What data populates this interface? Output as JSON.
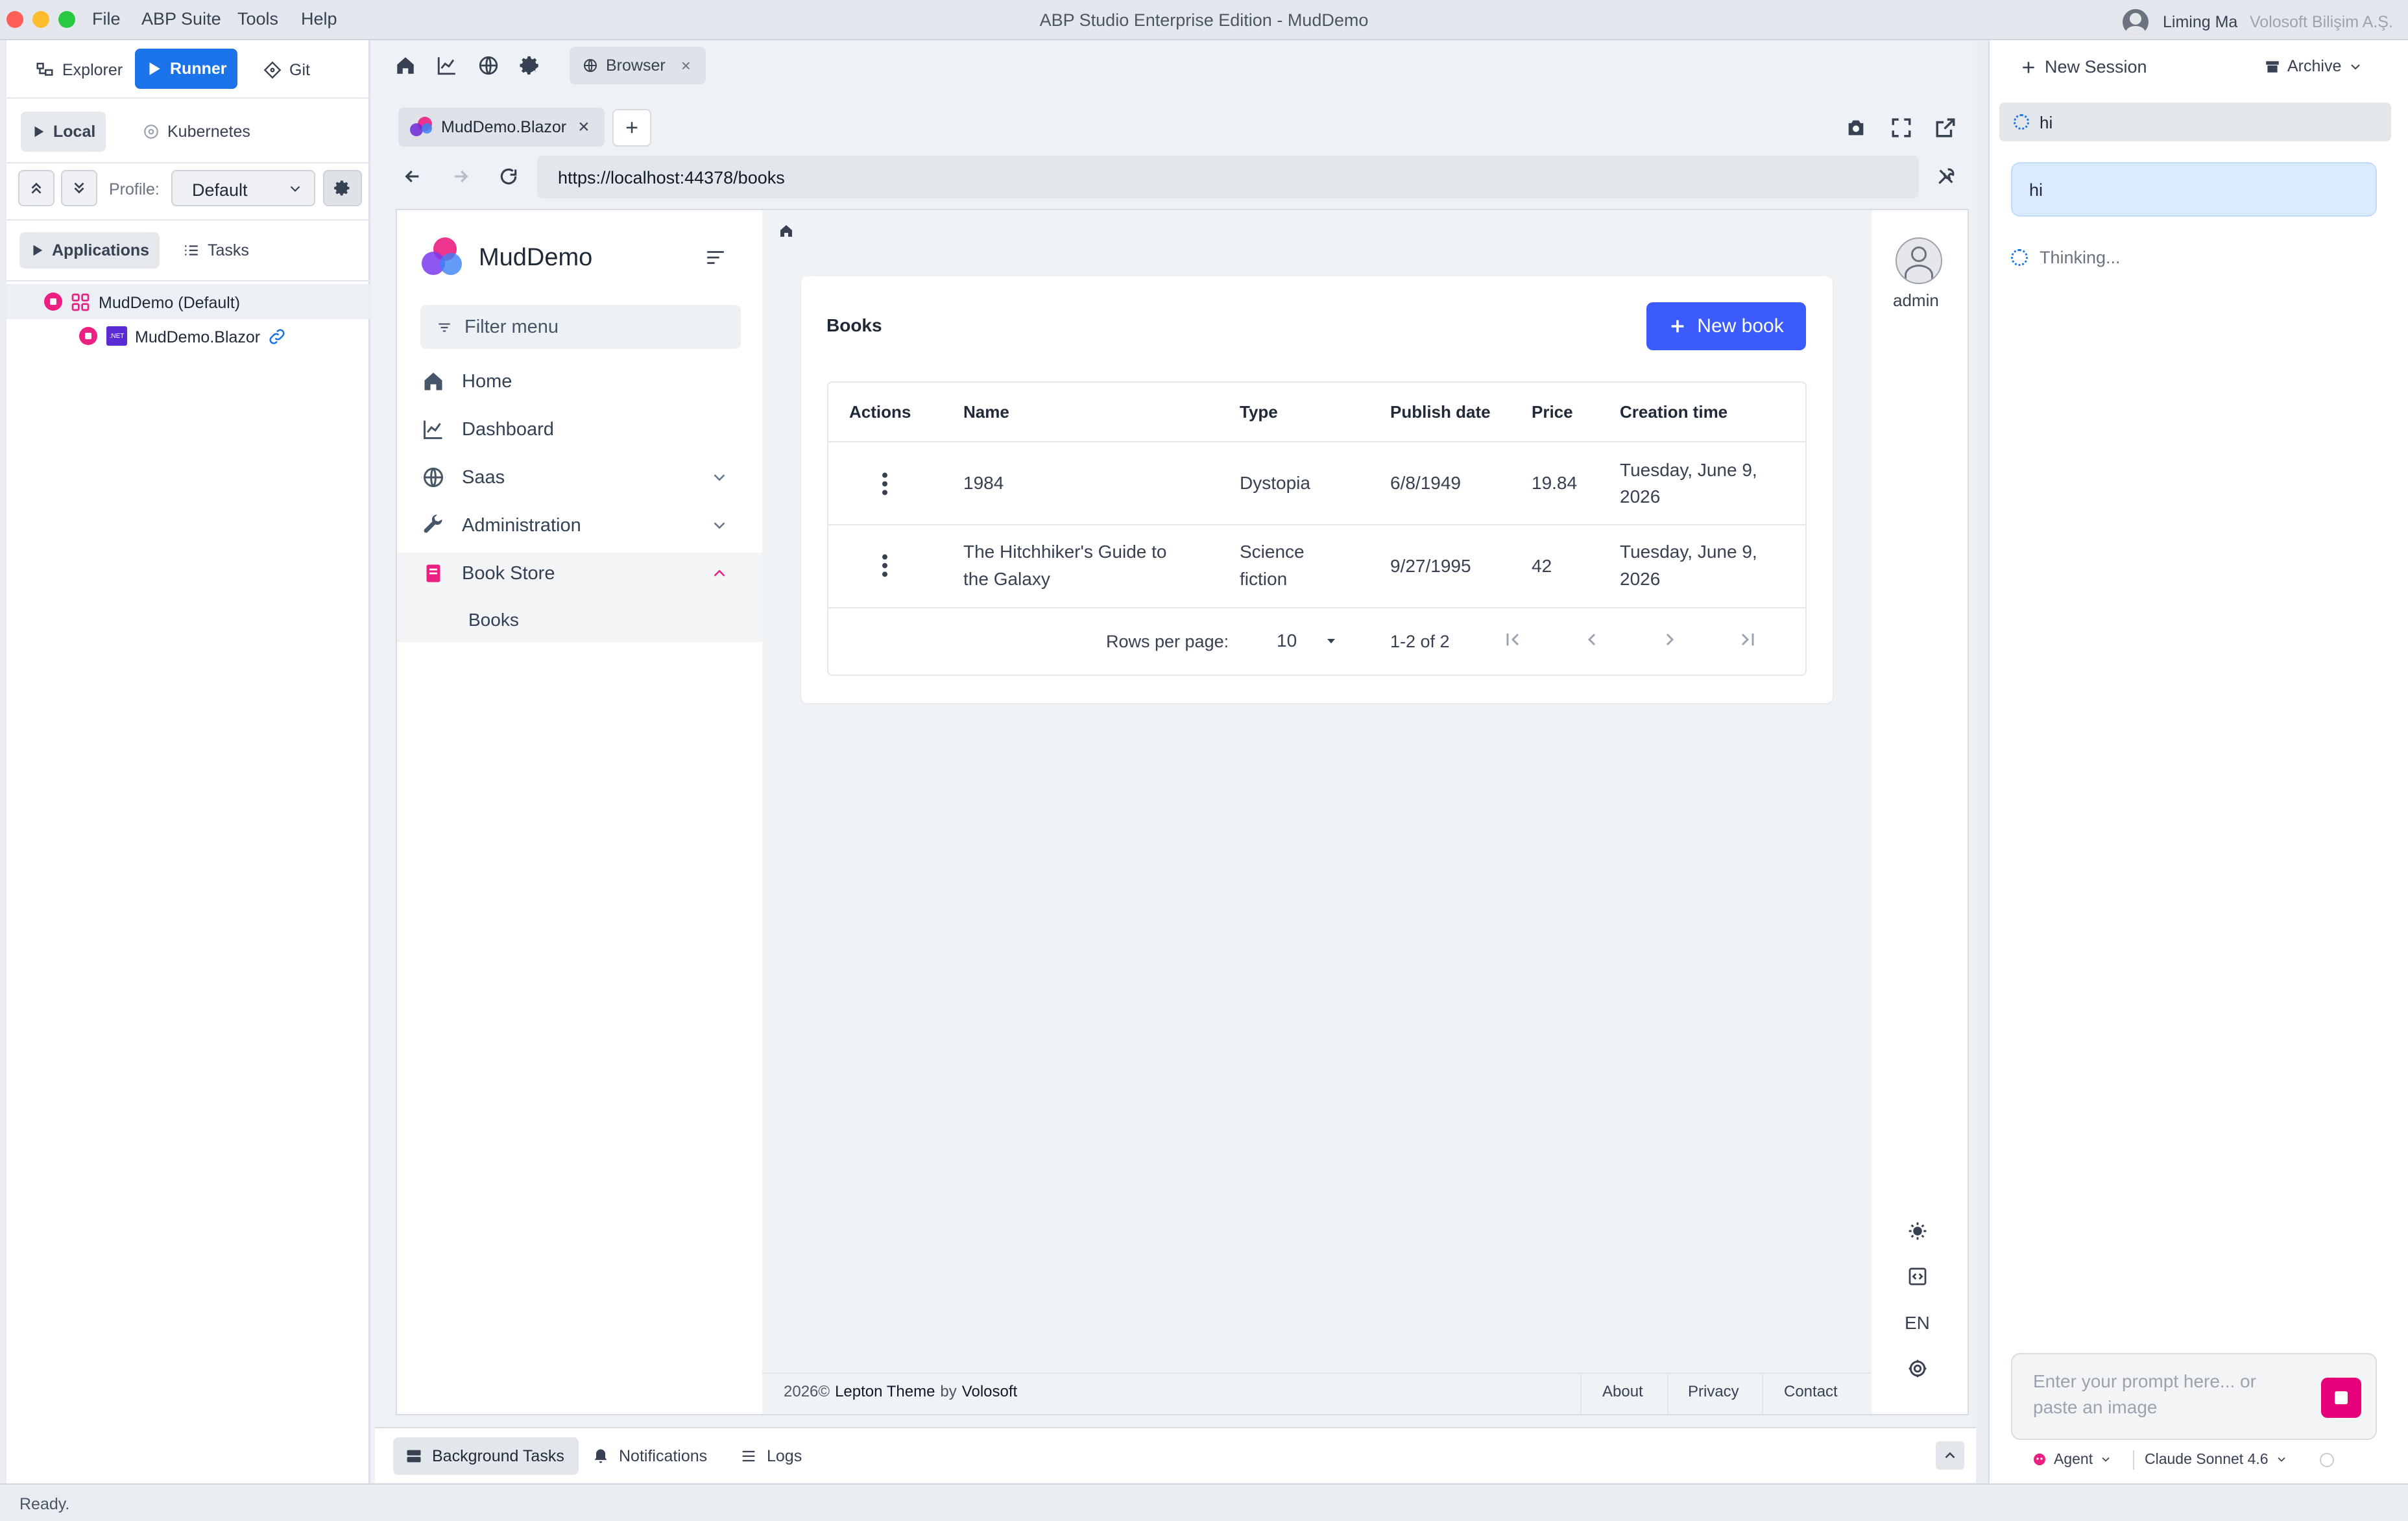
{
  "titlebar": {
    "menus": [
      "File",
      "ABP Suite",
      "Tools",
      "Help"
    ],
    "title": "ABP Studio Enterprise Edition - MudDemo",
    "user_name": "Liming Ma",
    "org_name": "Volosoft Bilişim A.Ş."
  },
  "left": {
    "tabs": {
      "explorer": "Explorer",
      "runner": "Runner",
      "git": "Git"
    },
    "env": {
      "local": "Local",
      "kubernetes": "Kubernetes"
    },
    "profile_label": "Profile:",
    "profile_value": "Default",
    "subtabs": {
      "applications": "Applications",
      "tasks": "Tasks"
    },
    "tree": [
      {
        "label": "MudDemo (Default)"
      },
      {
        "label": "MudDemo.Blazor"
      }
    ]
  },
  "toolbar": {
    "browser_tab": "Browser"
  },
  "browser": {
    "tab_label": "MudDemo.Blazor",
    "url": "https://localhost:44378/books"
  },
  "app": {
    "brand": "MudDemo",
    "filter_placeholder": "Filter menu",
    "nav": {
      "home": "Home",
      "dashboard": "Dashboard",
      "saas": "Saas",
      "administration": "Administration",
      "book_store": "Book Store",
      "books": "Books"
    },
    "user": "admin",
    "language": "EN",
    "books": {
      "title": "Books",
      "new_button": "New book",
      "columns": [
        "Actions",
        "Name",
        "Type",
        "Publish date",
        "Price",
        "Creation time"
      ],
      "rows": [
        {
          "name": "1984",
          "type": "Dystopia",
          "publish_date": "6/8/1949",
          "price": "19.84",
          "creation_line1": "Tuesday, June 9,",
          "creation_line2": "2026"
        },
        {
          "name_line1": "The Hitchhiker's Guide to",
          "name_line2": "the Galaxy",
          "type_line1": "Science",
          "type_line2": "fiction",
          "publish_date": "9/27/1995",
          "price": "42",
          "creation_line1": "Tuesday, June 9,",
          "creation_line2": "2026"
        }
      ],
      "rows_per_page_label": "Rows per page:",
      "rows_per_page": "10",
      "range": "1-2 of 2"
    },
    "footer": {
      "year": "2026©",
      "theme": "Lepton Theme",
      "by": "by",
      "company": "Volosoft",
      "links": [
        "About",
        "Privacy",
        "Contact"
      ]
    }
  },
  "bottom_tabs": {
    "background": "Background Tasks",
    "notifications": "Notifications",
    "logs": "Logs"
  },
  "chat": {
    "new_session": "New Session",
    "archive": "Archive",
    "session_item": "hi",
    "user_message": "hi",
    "thinking": "Thinking...",
    "prompt_placeholder_line1": "Enter your prompt here... or",
    "prompt_placeholder_line2": "paste an image",
    "mode": "Agent",
    "model": "Claude Sonnet 4.6"
  },
  "status": "Ready.",
  "colors": {
    "accent": "#1a73e8",
    "primary_button": "#3b5bfd",
    "stop": "#e6007a"
  }
}
